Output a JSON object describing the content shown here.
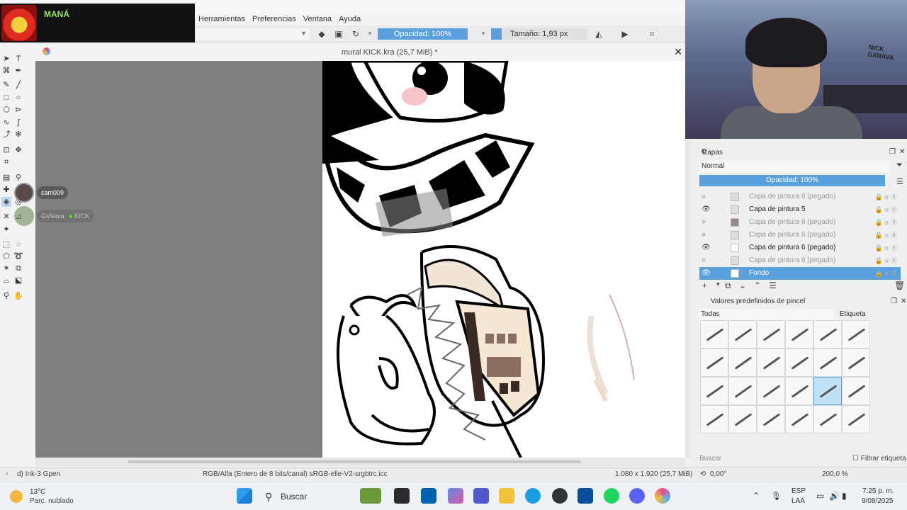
{
  "overlay": {
    "now_playing": "MANÁ"
  },
  "menu": [
    "Herramientas",
    "Preferencias",
    "Ventana",
    "Ayuda"
  ],
  "tool_options": {
    "opacity": "Opacidad: 100%",
    "size": "Tamaño: 1,93 px"
  },
  "document": {
    "tab_title": "mural KICK.kra (25,7 MiB) *"
  },
  "chat": [
    {
      "user": "cam009"
    },
    {
      "user": "GxNava",
      "badge": "KICK"
    }
  ],
  "layers_panel": {
    "title": "Capas",
    "blend_mode": "Normal",
    "opacity": "Opacidad:  100%",
    "layers": [
      {
        "name": "Capa de pintura 6 (pegado)",
        "visible": false
      },
      {
        "name": "Capa de pintura 5",
        "visible": true
      },
      {
        "name": "Capa de pintura 6 (pegado)",
        "visible": false
      },
      {
        "name": "Capa de pintura 6 (pegado)",
        "visible": false
      },
      {
        "name": "Capa de pintura 6 (pegado)",
        "visible": true
      },
      {
        "name": "Capa de pintura 6 (pegado)",
        "visible": false
      },
      {
        "name": "Fondo",
        "visible": true,
        "selected": true
      }
    ]
  },
  "brush_presets": {
    "title": "Valores predefinidos de pincel",
    "filter": "Todas",
    "tag_label": "Etiqueta",
    "search_placeholder": "Buscar",
    "tag_filter": "Filtrar etiqueta"
  },
  "statusbar": {
    "brush": "d) Ink-3 Gpen",
    "color_info": "RGB/Alfa (Entero de 8 bits/canal)  sRGB-elle-V2-srgbtrc.icc",
    "dimensions": "1.080 x 1.920 (25,7 MiB)",
    "rotation": "0,00°",
    "zoom": "200,0 %"
  },
  "webcam": {
    "sign": "NICK\nGXNAVA"
  },
  "taskbar": {
    "temperature": "13°C",
    "condition": "Parc. nublado",
    "search": "Buscar",
    "lang": "ESP",
    "region": "LAA",
    "time": "7:25 p. m.",
    "date": "9/08/2025"
  }
}
